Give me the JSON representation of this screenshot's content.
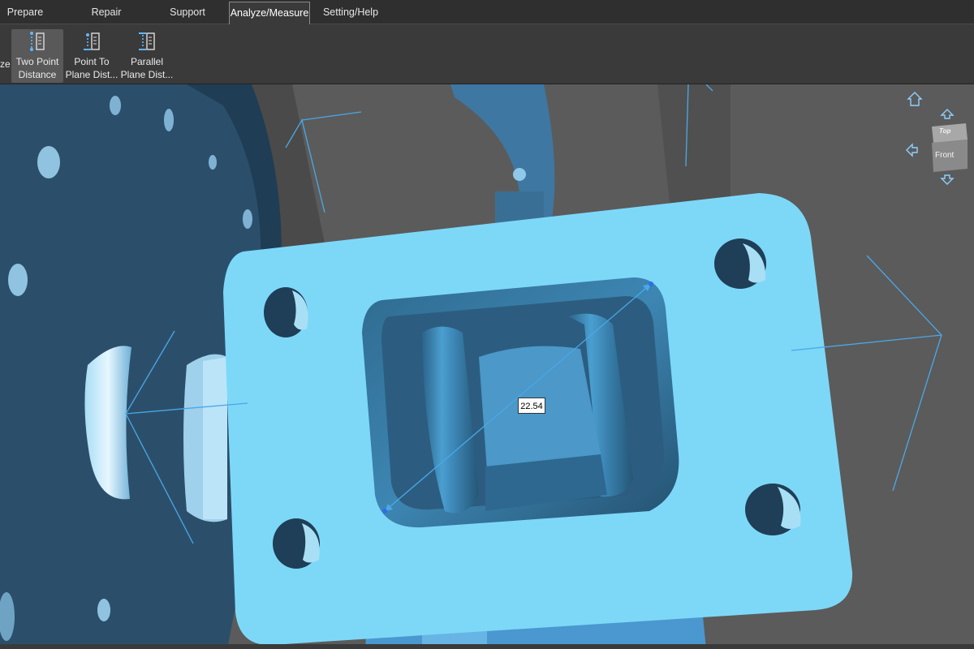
{
  "tabs": [
    {
      "label": "Prepare"
    },
    {
      "label": "Repair"
    },
    {
      "label": "Support"
    },
    {
      "label": "Analyze/Measure"
    },
    {
      "label": "Setting/Help"
    }
  ],
  "ribbon": {
    "cut_label": "ze",
    "tools": [
      {
        "line1": "Two Point",
        "line2": "Distance"
      },
      {
        "line1": "Point To",
        "line2": "Plane Dist..."
      },
      {
        "line1": "Parallel",
        "line2": "Plane Dist..."
      }
    ]
  },
  "viewport": {
    "measurement": "22.54",
    "viewcube": {
      "top": "Top",
      "front": "Front"
    }
  },
  "colors": {
    "part_light": "#7dd7f7",
    "part_dark": "#2a5f80",
    "background": "#5a5a5a",
    "measure_line": "#4aa8e8"
  }
}
